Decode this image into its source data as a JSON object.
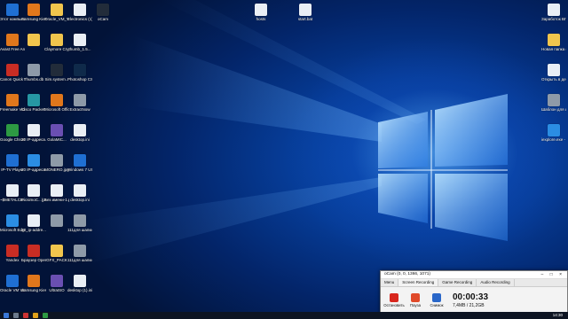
{
  "desktop": {
    "col1": [
      {
        "label": "Этот компьютер",
        "icon": "computer-icon",
        "color": "g-blue"
      },
      {
        "label": "Avast Free Antivirus",
        "icon": "avast-icon",
        "color": "g-orange"
      },
      {
        "label": "Canon Quick Menu",
        "icon": "canon-icon",
        "color": "g-red"
      },
      {
        "label": "Freemake Video C...",
        "icon": "freemake-icon",
        "color": "g-orange"
      },
      {
        "label": "Google Chrome",
        "icon": "chrome-icon",
        "color": "g-green"
      },
      {
        "label": "IP-TV Player",
        "icon": "iptv-icon",
        "color": "g-blue"
      },
      {
        "label": "~$METALCB...",
        "icon": "doc-icon",
        "color": "g-doc"
      },
      {
        "label": "Microsoft Edge",
        "icon": "edge-icon",
        "color": "g-ie"
      },
      {
        "label": "Yandex",
        "icon": "yandex-icon",
        "color": "g-red"
      },
      {
        "label": "Oracle VM VirtualBox",
        "icon": "virtualbox-icon",
        "color": "g-blue"
      }
    ],
    "col2": [
      {
        "label": "Samsung Kies",
        "icon": "kies-icon",
        "color": "g-orange"
      },
      {
        "label": "",
        "icon": "folder-icon",
        "color": "g-folder"
      },
      {
        "label": "Thumbs.db",
        "icon": "db-file-icon",
        "color": "g-gray"
      },
      {
        "label": "Cisco Packet Tracer",
        "icon": "cisco-icon",
        "color": "g-teal"
      },
      {
        "label": "20 IP-адреса...",
        "icon": "doc-icon",
        "color": "g-doc"
      },
      {
        "label": "20 IP-адреса...",
        "icon": "ie-shortcut-icon",
        "color": "g-ie"
      },
      {
        "label": "PicsimoC...(pst).psd",
        "icon": "psd-file-icon",
        "color": "g-doc"
      },
      {
        "label": "20_ip-addre...",
        "icon": "doc-icon",
        "color": "g-doc"
      },
      {
        "label": "Браузер Opera",
        "icon": "opera-icon",
        "color": "g-red"
      },
      {
        "label": "Samsung Kies (Lite)",
        "icon": "kies-lite-icon",
        "color": "g-orange"
      }
    ],
    "col3": [
      {
        "label": "Oracle_VM_Virtu...",
        "icon": "folder-icon",
        "color": "g-folder"
      },
      {
        "label": "Claymore CryptoNot...",
        "icon": "folder-icon",
        "color": "g-folder"
      },
      {
        "label": "Sim.system...",
        "icon": "app-icon",
        "color": "g-dark"
      },
      {
        "label": "Microsoft Office 2010",
        "icon": "office-icon",
        "color": "g-orange"
      },
      {
        "label": "GolaMIC...",
        "icon": "app-icon",
        "color": "g-purple"
      },
      {
        "label": "MONERO.jpg",
        "icon": "image-file-icon",
        "color": "g-gray"
      },
      {
        "label": "Без имени-1.psd",
        "icon": "psd-file-icon",
        "color": "g-doc"
      },
      {
        "label": "",
        "icon": "image-file-icon",
        "color": "g-gray"
      },
      {
        "label": "GFX_PACK",
        "icon": "folder-icon",
        "color": "g-folder"
      },
      {
        "label": "UltraISO",
        "icon": "ultraiso-icon",
        "color": "g-purple"
      }
    ],
    "col4": [
      {
        "label": "Electronics (1).pdf",
        "icon": "pdf-icon",
        "color": "g-doc"
      },
      {
        "label": "thumb_1.5...",
        "icon": "doc-icon",
        "color": "g-doc"
      },
      {
        "label": "Photoshop CS6 x64",
        "icon": "photoshop-icon",
        "color": "g-ps"
      },
      {
        "label": "ExtractNow",
        "icon": "extract-icon",
        "color": "g-gray"
      },
      {
        "label": "desktop.ini",
        "icon": "ini-file-icon",
        "color": "g-doc"
      },
      {
        "label": "Windows 7 USB DVD...",
        "icon": "usb-tool-icon",
        "color": "g-blue"
      },
      {
        "label": "desktop.ini",
        "icon": "ini-file-icon",
        "color": "g-doc"
      },
      {
        "label": "111для шапки на...",
        "icon": "image-file-icon",
        "color": "g-gray"
      },
      {
        "label": "111для шапки на...",
        "icon": "image-file-icon",
        "color": "g-gray"
      },
      {
        "label": "desktop (1).ini",
        "icon": "ini-file-icon",
        "color": "g-doc"
      }
    ],
    "top_extra": [
      {
        "label": "oCam",
        "icon": "ocam-icon",
        "color": "g-dark"
      },
      {
        "label": "hosts",
        "icon": "doc-icon",
        "color": "g-doc"
      },
      {
        "label": "start.bat",
        "icon": "bat-file-icon",
        "color": "g-doc"
      }
    ],
    "right_col": [
      {
        "label": "Заработок BITCOIN. B...",
        "icon": "doc-icon",
        "color": "g-doc"
      },
      {
        "label": "Новая папка (3)",
        "icon": "folder-icon",
        "color": "g-folder"
      },
      {
        "label": "Открыть в декс Ко...",
        "icon": "doc-icon",
        "color": "g-doc"
      },
      {
        "label": "Шаблон для шапки о...",
        "icon": "image-file-icon",
        "color": "g-gray"
      },
      {
        "label": "iexplore.exe - Ярлык",
        "icon": "ie-icon",
        "color": "g-ie"
      }
    ]
  },
  "ocam": {
    "title": "oCam (0, 0, 1366, 1071)",
    "window_buttons": "– □ ×",
    "tabs": [
      "Menu",
      "Screen Recording",
      "Game Recording",
      "Audio Recording"
    ],
    "tools": [
      {
        "label": "Остановить",
        "icon": "stop-icon"
      },
      {
        "label": "Пауза",
        "icon": "pause-icon"
      },
      {
        "label": "Снимок",
        "icon": "screenshot-icon"
      }
    ],
    "elapsed": "00:00:33",
    "size": "7,4MB / 21,2GB"
  },
  "taskbar": {
    "clock": "14:30",
    "colors": {
      "start": "#3a78d8",
      "search": "#6c7a8c",
      "app1": "#c33",
      "app2": "#e0a21b",
      "app3": "#2d9a43"
    }
  }
}
